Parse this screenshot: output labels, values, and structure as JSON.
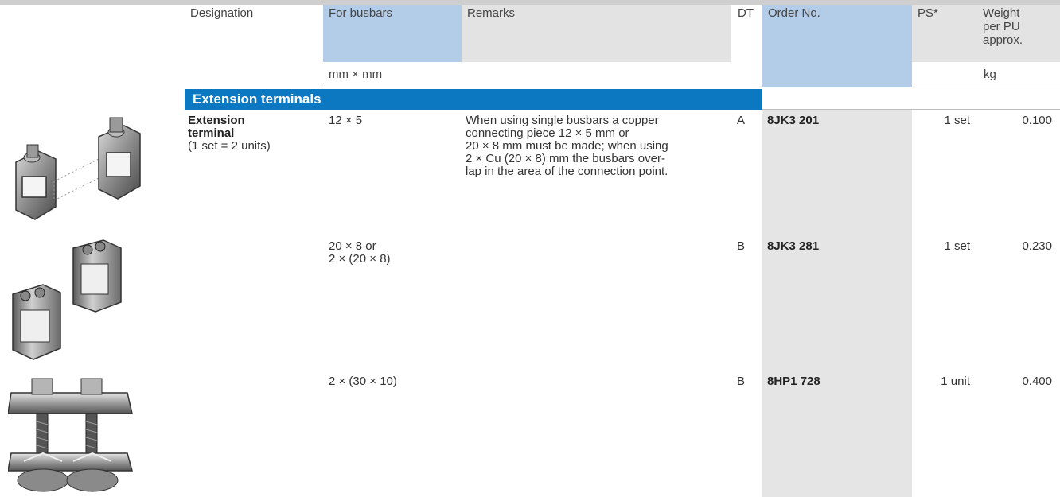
{
  "header": {
    "designation": "Designation",
    "for_busbars": "For busbars",
    "remarks": "Remarks",
    "dt": "DT",
    "order_no": "Order No.",
    "ps": "PS*",
    "weight_line1": "Weight",
    "weight_line2": "per PU",
    "weight_line3": "approx."
  },
  "units": {
    "busbars": "mm × mm",
    "weight": "kg"
  },
  "section_title": "Extension terminals",
  "designation": {
    "name_line1": "Extension",
    "name_line2": "terminal",
    "note": "(1 set = 2 units)"
  },
  "rows": [
    {
      "busbars_lines": [
        "12 × 5"
      ],
      "remarks_lines": [
        "When using single busbars a copper",
        "connecting piece 12 × 5 mm or",
        "20 × 8 mm must be made; when using",
        "2 × Cu (20 × 8) mm the busbars over-",
        "lap in the area of the connection point."
      ],
      "dt": "A",
      "order_no": "8JK3 201",
      "ps": "1 set",
      "weight": "0.100"
    },
    {
      "busbars_lines": [
        "20 × 8 or",
        "2 × (20 × 8)"
      ],
      "remarks_lines": [],
      "dt": "B",
      "order_no": "8JK3 281",
      "ps": "1 set",
      "weight": "0.230"
    },
    {
      "busbars_lines": [
        "2 × (30 × 10)"
      ],
      "remarks_lines": [],
      "dt": "B",
      "order_no": "8HP1 728",
      "ps": "1 unit",
      "weight": "0.400"
    }
  ],
  "images": [
    {
      "icon": "extension-terminal-pair-photo"
    },
    {
      "icon": "extension-terminal-clamp-photo"
    },
    {
      "icon": "double-bolt-clamp-photo"
    }
  ],
  "colors": {
    "section_blue": "#0d78c2",
    "header_blue": "#b3cde8",
    "header_grey": "#e3e3e3",
    "order_column_grey": "#e5e5e5"
  }
}
